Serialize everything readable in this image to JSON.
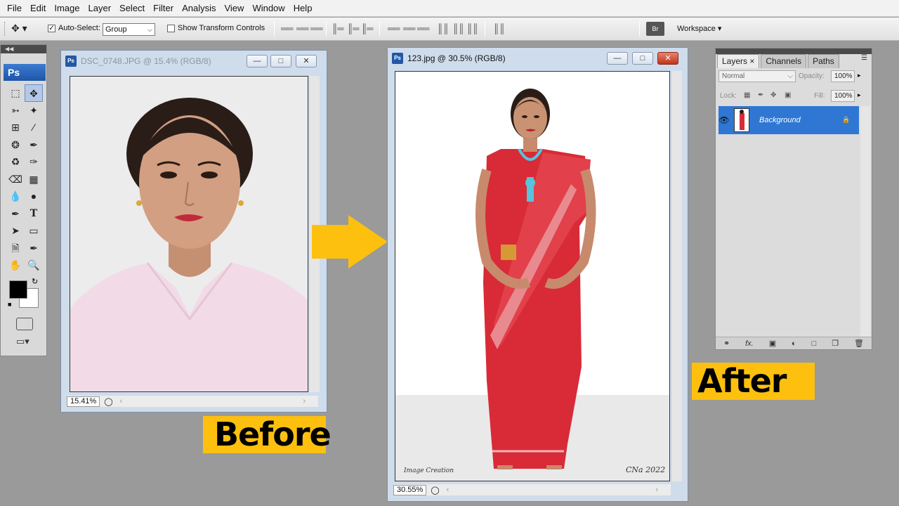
{
  "menu": [
    "File",
    "Edit",
    "Image",
    "Layer",
    "Select",
    "Filter",
    "Analysis",
    "View",
    "Window",
    "Help"
  ],
  "options_bar": {
    "auto_select_label": "Auto-Select:",
    "auto_select_checked": true,
    "group_value": "Group",
    "show_transform_label": "Show Transform Controls",
    "workspace_label": "Workspace ▾"
  },
  "tools": {
    "logo": "Ps",
    "foreground_color": "#000000",
    "background_color": "#ffffff"
  },
  "doc_before": {
    "title": "DSC_0748.JPG @ 15.4% (RGB/8)",
    "zoom": "15.41%"
  },
  "doc_after": {
    "title": "123.jpg @ 30.5% (RGB/8)",
    "zoom": "30.55%",
    "watermark_left": "Image Creation",
    "watermark_right": "CNa 2022"
  },
  "layers_panel": {
    "tabs": [
      "Layers",
      "Channels",
      "Paths"
    ],
    "blend_mode": "Normal",
    "opacity_label": "Opacity:",
    "opacity_value": "100%",
    "lock_label": "Lock:",
    "fill_label": "Fill:",
    "fill_value": "100%",
    "layer_name": "Background"
  },
  "annotations": {
    "before": "Before",
    "after": "After",
    "accent": "#fdc00f",
    "arrow_color": "#fdc00f"
  }
}
